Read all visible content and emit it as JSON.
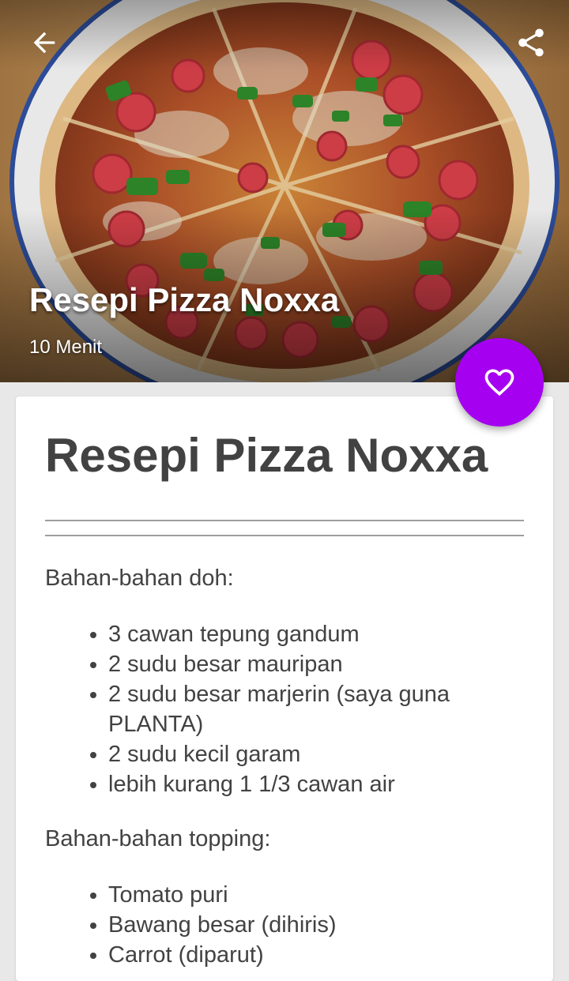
{
  "recipe": {
    "hero_title": "Resepi Pizza Noxxa",
    "duration": "10 Menit",
    "title": "Resepi Pizza Noxxa"
  },
  "toolbar": {
    "back_icon": "arrow-back-icon",
    "share_icon": "share-icon",
    "favorite_icon": "heart-outline-icon"
  },
  "colors": {
    "fab": "#a600f0",
    "text": "#424242",
    "background": "#e8e8e8"
  },
  "sections": [
    {
      "label": "Bahan-bahan doh:",
      "items": [
        "3 cawan tepung gandum",
        "2 sudu besar mauripan",
        "2 sudu besar marjerin (saya guna PLANTA)",
        "2 sudu kecil garam",
        "lebih kurang 1 1/3 cawan air"
      ]
    },
    {
      "label": "Bahan-bahan topping:",
      "items": [
        "Tomato puri",
        "Bawang besar (dihiris)",
        "Carrot (diparut)"
      ]
    }
  ]
}
